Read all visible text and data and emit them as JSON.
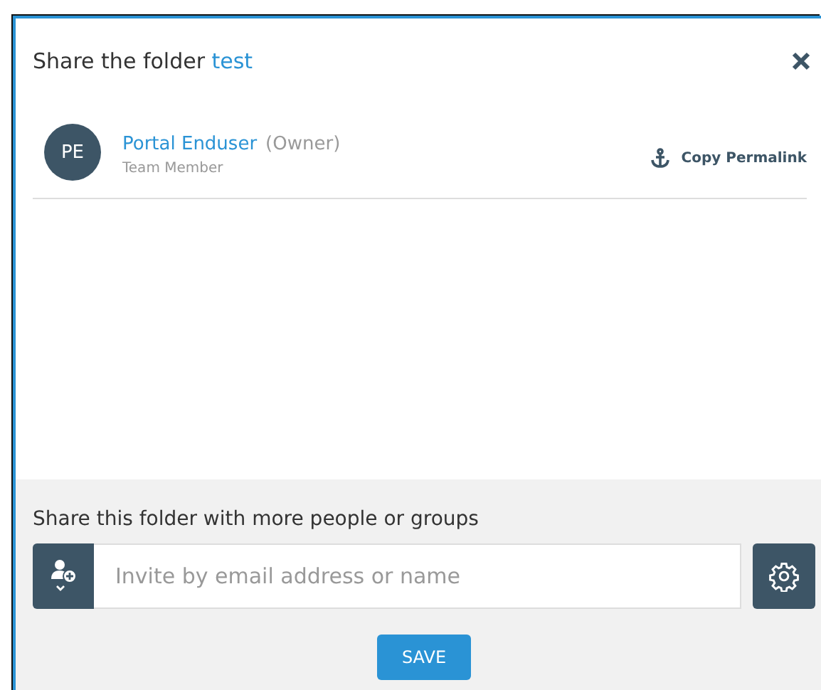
{
  "dialog": {
    "title": "Share the folder",
    "folder_name": "test"
  },
  "members": [
    {
      "initials": "PE",
      "name": "Portal Enduser",
      "role": "(Owner)",
      "subtitle": "Team Member"
    }
  ],
  "permalink": "Copy Permalink",
  "share": {
    "heading": "Share this folder with more people or groups",
    "placeholder": "Invite by email address or name"
  },
  "buttons": [
    "SAVE"
  ]
}
